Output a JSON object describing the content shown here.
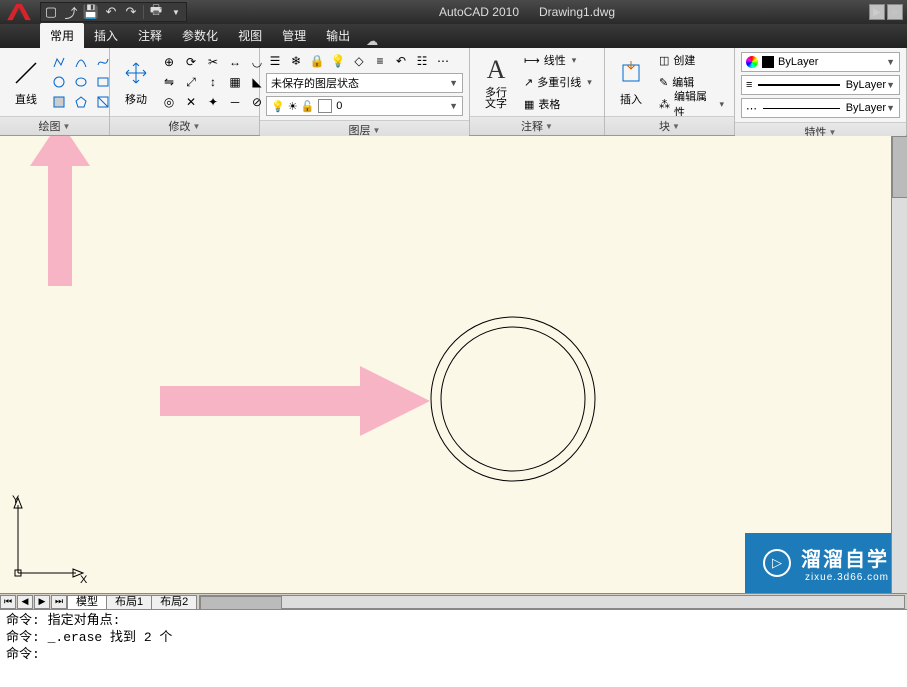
{
  "title": {
    "app": "AutoCAD 2010",
    "doc": "Drawing1.dwg"
  },
  "qat_icons": [
    "new",
    "open",
    "save",
    "undo",
    "redo",
    "print",
    "dropdown"
  ],
  "tabs": {
    "items": [
      "常用",
      "插入",
      "注释",
      "参数化",
      "视图",
      "管理",
      "输出"
    ],
    "active": 0
  },
  "panels": {
    "draw": {
      "title": "绘图",
      "line_label": "直线"
    },
    "modify": {
      "title": "修改",
      "move_label": "移动"
    },
    "layer": {
      "title": "图层",
      "state_label": "未保存的图层状态",
      "current": "0"
    },
    "anno": {
      "title": "注释",
      "mtext": "多行\n文字",
      "items": [
        "线性",
        "多重引线",
        "表格"
      ]
    },
    "block": {
      "title": "块",
      "insert": "插入",
      "items": [
        "创建",
        "编辑",
        "编辑属性"
      ]
    },
    "prop": {
      "title": "特性",
      "color": "ByLayer",
      "lw": "ByLayer",
      "lt": "ByLayer"
    }
  },
  "layout_tabs": [
    "模型",
    "布局1",
    "布局2"
  ],
  "cmd_lines": [
    "命令: 指定对角点:",
    "命令: _.erase 找到 2 个",
    "",
    "命令:"
  ],
  "watermark": {
    "title": "溜溜自学",
    "sub": "zixue.3d66.com"
  },
  "ucs": {
    "x": "X",
    "y": "Y"
  },
  "colors": {
    "accent_pink": "#f7b4c5",
    "canvas": "#fbf8e8",
    "watermark": "#1d7bb9",
    "red": "#d8232a"
  }
}
